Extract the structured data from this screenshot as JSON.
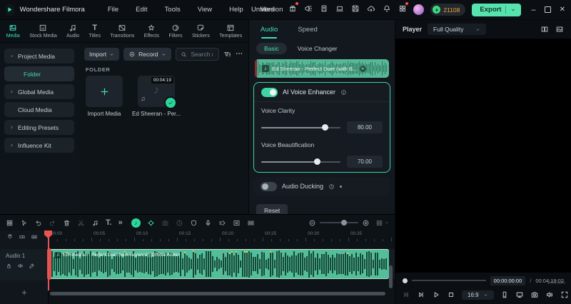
{
  "titlebar": {
    "brand": "Wondershare Filmora",
    "menus": [
      "File",
      "Edit",
      "Tools",
      "View",
      "Help",
      "Version"
    ],
    "project_title": "Untitled",
    "coins": "21108",
    "export_label": "Export",
    "icons": [
      {
        "name": "gift",
        "badge": true
      },
      {
        "name": "megaphone",
        "badge": false
      },
      {
        "name": "script",
        "badge": false
      },
      {
        "name": "laptop",
        "badge": false
      },
      {
        "name": "save",
        "badge": false
      },
      {
        "name": "cloud-upload",
        "badge": false
      },
      {
        "name": "bell",
        "badge": false
      },
      {
        "name": "apps",
        "badge": true
      }
    ]
  },
  "left_tabs": [
    {
      "label": "Media",
      "icon": "media",
      "active": true
    },
    {
      "label": "Stock Media",
      "icon": "smile",
      "active": false
    },
    {
      "label": "Audio",
      "icon": "note",
      "active": false
    },
    {
      "label": "Titles",
      "icon": "titles",
      "active": false
    },
    {
      "label": "Transitions",
      "icon": "transitions",
      "active": false
    },
    {
      "label": "Effects",
      "icon": "effects",
      "active": false
    },
    {
      "label": "Filters",
      "icon": "filters",
      "active": false
    },
    {
      "label": "Stickers",
      "icon": "stickers",
      "active": false
    },
    {
      "label": "Templates",
      "icon": "templates",
      "active": false
    }
  ],
  "sidebar": {
    "items": [
      {
        "label": "Project Media",
        "caret": "down",
        "indent": "none",
        "active": false
      },
      {
        "label": "Folder",
        "caret": "",
        "indent": "deep",
        "active": true
      },
      {
        "label": "Global Media",
        "caret": "right",
        "indent": "none",
        "active": false
      },
      {
        "label": "Cloud Media",
        "caret": "",
        "indent": "small",
        "active": false
      },
      {
        "label": "Editing Presets",
        "caret": "right",
        "indent": "none",
        "active": false
      },
      {
        "label": "Influence Kit",
        "caret": "right",
        "indent": "none",
        "active": false
      }
    ]
  },
  "media_panel": {
    "import_button": "Import",
    "record_button": "Record",
    "search_placeholder": "Search media",
    "section_label": "FOLDER",
    "items": [
      {
        "type": "import",
        "label": "Import Media"
      },
      {
        "type": "audio",
        "label": "Ed Sheeran - Per...",
        "duration": "00:04:19"
      }
    ]
  },
  "properties": {
    "tabs": [
      "Audio",
      "Speed"
    ],
    "subtabs": [
      "Basic",
      "Voice Changer"
    ],
    "clip_label": "Ed Sheeran - Perfect Duet (with B...",
    "ai_voice_enhancer": {
      "label": "AI Voice Enhancer",
      "enabled": true,
      "sliders": [
        {
          "label": "Voice Clarity",
          "value": "80.00",
          "percent": 80
        },
        {
          "label": "Voice Beautification",
          "value": "70.00",
          "percent": 70
        }
      ]
    },
    "audio_ducking": {
      "label": "Audio Ducking",
      "enabled": false
    },
    "reset_label": "Reset"
  },
  "player": {
    "label": "Player",
    "quality": "Full Quality",
    "header_icons": [
      {
        "name": "compare-view"
      },
      {
        "name": "scopes"
      }
    ],
    "current_time": "00:00:00:00",
    "separator": "/",
    "total_time": "00:04:19:02",
    "aspect_ratio": "16:9",
    "transport": [
      {
        "name": "prev-frame",
        "dim": true
      },
      {
        "name": "next-frame",
        "dim": false
      },
      {
        "name": "play",
        "dim": false
      },
      {
        "name": "stop",
        "dim": false
      }
    ],
    "right_icons": [
      {
        "name": "marker"
      },
      {
        "name": "cast-display"
      },
      {
        "name": "camera"
      },
      {
        "name": "volume"
      },
      {
        "name": "fullscreen"
      }
    ],
    "watermark": "wmv.com"
  },
  "timeline": {
    "toolbar_left": [
      {
        "name": "apps"
      },
      {
        "name": "cursor"
      },
      {
        "name": "undo"
      },
      {
        "name": "redo",
        "dim": true
      },
      {
        "name": "trash"
      },
      {
        "name": "scissors",
        "dim": true
      },
      {
        "name": "music-note"
      },
      {
        "name": "text-tool",
        "glyph": "T."
      },
      {
        "name": "more-chevrons",
        "glyph": "»"
      }
    ],
    "toolbar_mid": [
      {
        "name": "voice-enhancer",
        "special": "circle"
      },
      {
        "name": "keyframe",
        "teal": true
      },
      {
        "name": "camera",
        "dim": true
      },
      {
        "name": "clock",
        "dim": true
      },
      {
        "name": "mask"
      },
      {
        "name": "mic"
      },
      {
        "name": "speed-ramp"
      },
      {
        "name": "screen-record"
      },
      {
        "name": "auto-ripple"
      }
    ],
    "zoom_level_percent": 55,
    "ruler_labels": [
      "00:00",
      "00:05",
      "00:10",
      "00:15",
      "00:20",
      "00:25",
      "00:30",
      "00:35"
    ],
    "trackhead_icons": [
      {
        "name": "magnet"
      },
      {
        "name": "link-box"
      },
      {
        "name": "keyboard"
      }
    ],
    "track_name": "Audio 1",
    "track_icons": [
      {
        "name": "lock"
      },
      {
        "name": "volume"
      },
      {
        "name": "mic-slant"
      }
    ],
    "clip_label": "Ed Sheeran - Perfect Duet (with Beyoncé) [Official Audio]"
  },
  "colors": {
    "accent": "#42debc",
    "export_bg": "#57e3ae",
    "clip_green": "#54bd9a",
    "coin_text": "#f0a43c",
    "playhead_red": "#e85353"
  }
}
